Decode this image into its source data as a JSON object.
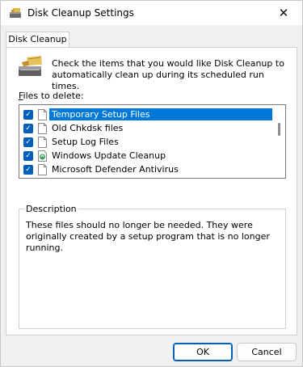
{
  "window": {
    "title": "Disk Cleanup Settings",
    "close_glyph": "✕"
  },
  "tab": {
    "label": "Disk Cleanup"
  },
  "intro_text": "Check the items that you would like Disk Cleanup to automatically clean up during its scheduled run times.",
  "files_label": "Files to delete:",
  "files": [
    {
      "label": "Temporary Setup Files",
      "checked": true,
      "selected": true,
      "icon": "document-icon"
    },
    {
      "label": "Old Chkdsk files",
      "checked": true,
      "selected": false,
      "icon": "document-icon"
    },
    {
      "label": "Setup Log Files",
      "checked": true,
      "selected": false,
      "icon": "document-icon"
    },
    {
      "label": "Windows Update Cleanup",
      "checked": true,
      "selected": false,
      "icon": "recycle-icon"
    },
    {
      "label": "Microsoft Defender Antivirus",
      "checked": true,
      "selected": false,
      "icon": "document-icon"
    }
  ],
  "description": {
    "title": "Description",
    "text": "These files should no longer be needed. They were originally created by a setup program that is no longer running."
  },
  "buttons": {
    "ok": "OK",
    "cancel": "Cancel"
  },
  "colors": {
    "selection": "#0078d7",
    "checkbox": "#005fb8"
  }
}
